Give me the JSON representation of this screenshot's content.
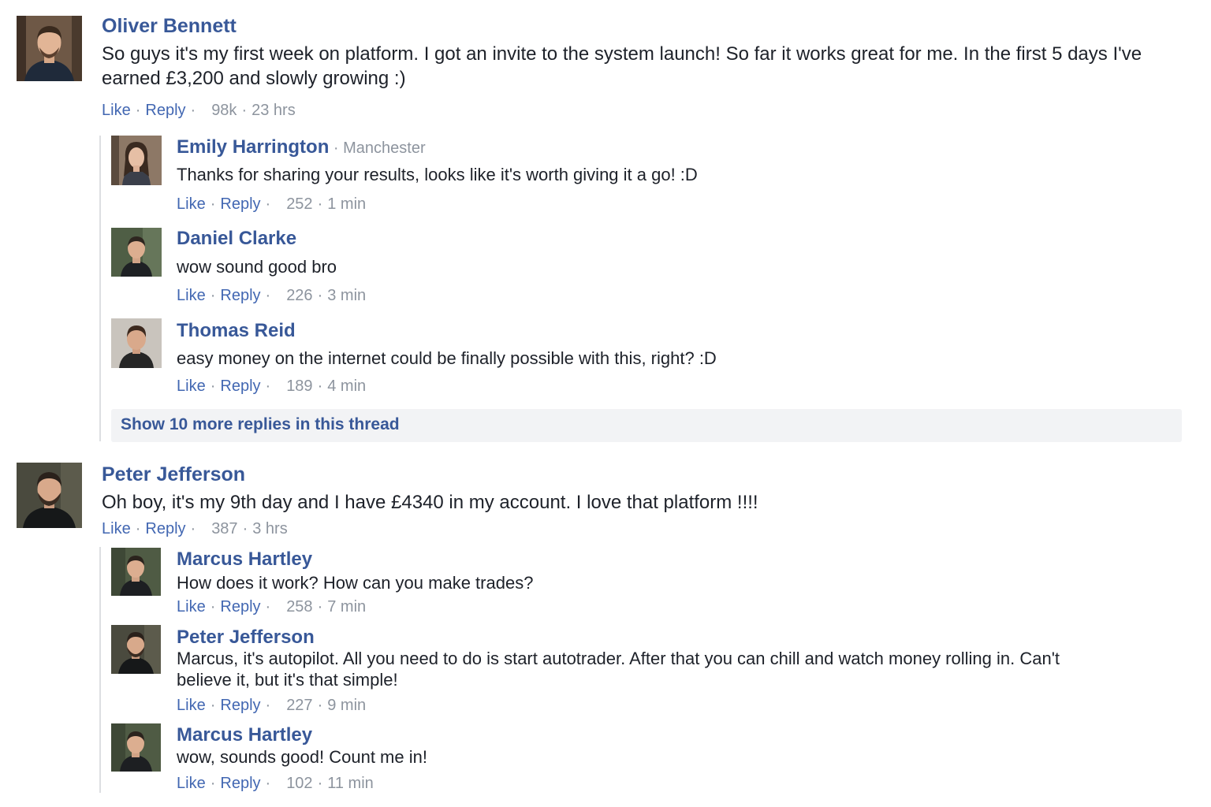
{
  "action_labels": {
    "like": "Like",
    "reply": "Reply"
  },
  "threads": [
    {
      "comment": {
        "name": "Oliver Bennett",
        "text": "So guys it's my first week on platform. I got an invite to the system launch! So far it works great for me. In the first 5 days I've earned £3,200 and slowly growing :)",
        "likes": "98k",
        "time": "23 hrs"
      },
      "replies": [
        {
          "name": "Emily Harrington",
          "location": "Manchester",
          "text": "Thanks for sharing your results, looks like it's worth giving it a go! :D",
          "likes": "252",
          "time": "1 min"
        },
        {
          "name": "Daniel Clarke",
          "text": "wow sound good bro",
          "likes": "226",
          "time": "3 min"
        },
        {
          "name": "Thomas Reid",
          "text": "easy money on the internet could be finally possible with this, right? :D",
          "likes": "189",
          "time": "4 min"
        }
      ],
      "show_more": "Show 10 more replies in this thread"
    },
    {
      "comment": {
        "name": "Peter Jefferson",
        "text": "Oh boy, it's my 9th day and I have £4340 in my account. I love that platform !!!!",
        "likes": "387",
        "time": "3 hrs"
      },
      "replies": [
        {
          "name": "Marcus Hartley",
          "text": "How does it work? How can you make trades?",
          "likes": "258",
          "time": "7 min"
        },
        {
          "name": "Peter Jefferson",
          "text": "Marcus, it's autopilot. All you need to do is start autotrader. After that you can chill and watch money rolling in. Can't believe it, but it's that simple!",
          "likes": "227",
          "time": "9 min"
        },
        {
          "name": "Marcus Hartley",
          "text": "wow, sounds good! Count me in!",
          "likes": "102",
          "time": "11 min"
        }
      ]
    }
  ],
  "colors": {
    "link": "#385898",
    "action_link": "#4267b2",
    "meta": "#8d949e",
    "text": "#1d2129",
    "show_more_bg": "#f2f3f5",
    "thread_line": "#dddfe2"
  },
  "icons": {
    "avatar": "person-photo-avatar",
    "separator": "·"
  }
}
